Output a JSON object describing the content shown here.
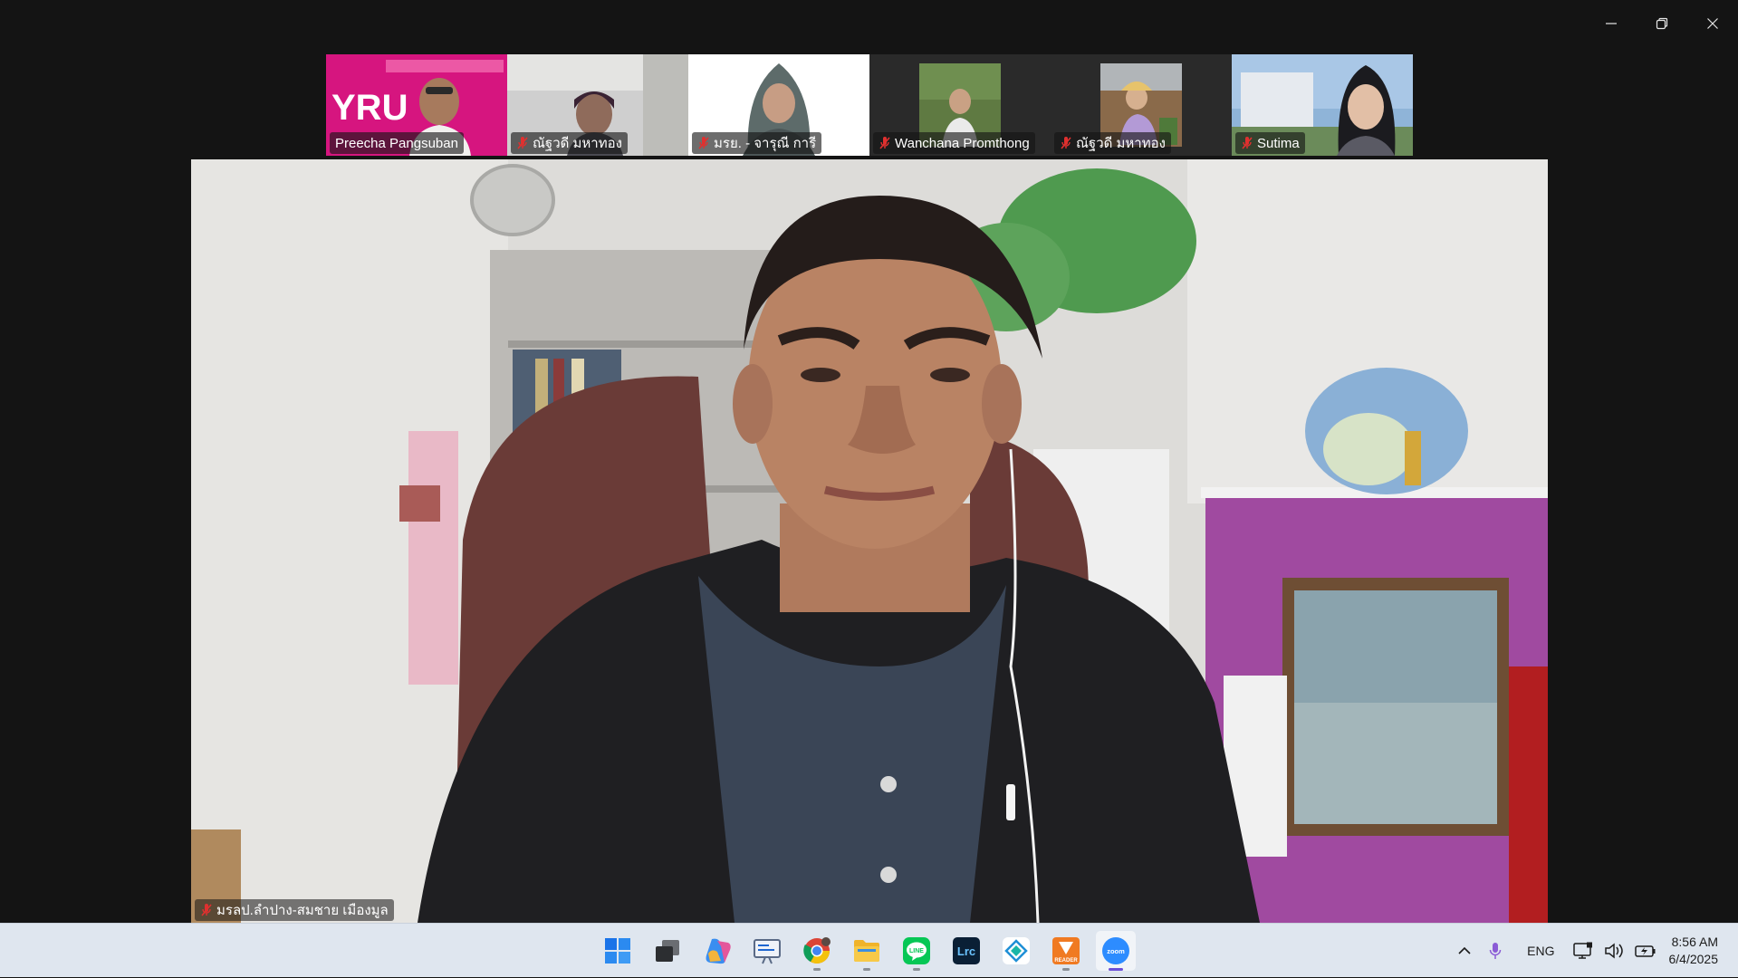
{
  "window": {
    "controls": {
      "minimize": "minimize-icon",
      "restore": "restore-icon",
      "close": "close-icon"
    }
  },
  "gallery": {
    "participants": [
      {
        "name": "Preecha Pangsuban",
        "muted": false,
        "theme": "pink"
      },
      {
        "name": "ณัฐวดี มหาทอง",
        "muted": true,
        "theme": "office"
      },
      {
        "name": "มรย. - จารุณี การี",
        "muted": true,
        "theme": "white"
      },
      {
        "name": "Wanchana Promthong",
        "muted": true,
        "theme": "dark-photo"
      },
      {
        "name": "ณัฐวดี มหาทอง",
        "muted": true,
        "theme": "dark-photo2"
      },
      {
        "name": "Sutima",
        "muted": true,
        "theme": "sky"
      }
    ]
  },
  "speaker": {
    "name": "มรลป.ลำปาง-สมชาย เมืองมูล",
    "muted": true
  },
  "taskbar": {
    "apps": [
      {
        "name": "windows-start",
        "active": false,
        "running": false
      },
      {
        "name": "task-view",
        "active": false,
        "running": false
      },
      {
        "name": "copilot",
        "active": false,
        "running": false
      },
      {
        "name": "widgets",
        "active": false,
        "running": false
      },
      {
        "name": "chrome",
        "active": false,
        "running": true
      },
      {
        "name": "file-explorer",
        "active": false,
        "running": true
      },
      {
        "name": "line",
        "active": false,
        "running": true
      },
      {
        "name": "lightroom-classic",
        "active": false,
        "running": false,
        "text": "Lrc"
      },
      {
        "name": "app-diamond",
        "active": false,
        "running": false
      },
      {
        "name": "reader",
        "active": false,
        "running": true,
        "text": "READER"
      },
      {
        "name": "zoom",
        "active": true,
        "running": true,
        "text": "zoom"
      }
    ],
    "tray": {
      "language": "ENG",
      "time": "8:56 AM",
      "date": "6/4/2025"
    }
  },
  "colors": {
    "muted_red": "#e0302f",
    "zoom_blue": "#2d8cff",
    "line_green": "#06c755",
    "active_indicator": "#6b4fd8"
  }
}
